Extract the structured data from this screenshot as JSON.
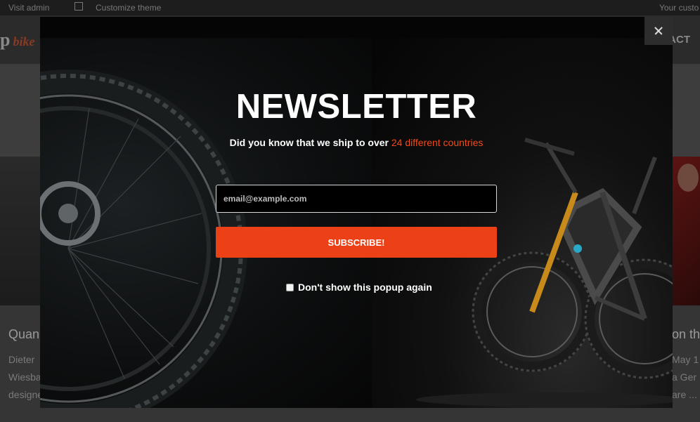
{
  "admin_bar": {
    "visit": "Visit admin",
    "customize": "Customize theme",
    "right": "Your custo"
  },
  "header": {
    "logo": "p",
    "logo_sub": "bike",
    "nav_right": "ACT"
  },
  "cards": {
    "left_title": "Quan",
    "left_lines": [
      "Dieter",
      "Wiesba",
      "designe"
    ],
    "right_title": "on th",
    "right_lines": [
      "May 1",
      "a Ger",
      "are ..."
    ]
  },
  "popup": {
    "title": "NEWSLETTER",
    "subtitle_prefix": "Did you know that we ship to over ",
    "subtitle_highlight": "24 different countries",
    "email_placeholder": "email@example.com",
    "email_value": "",
    "subscribe_label": "SUBSCRIBE!",
    "dont_show_label": "Don't show this popup again",
    "dont_show_checked": false,
    "close_icon": "close-icon",
    "accent_color": "#ec4117"
  }
}
